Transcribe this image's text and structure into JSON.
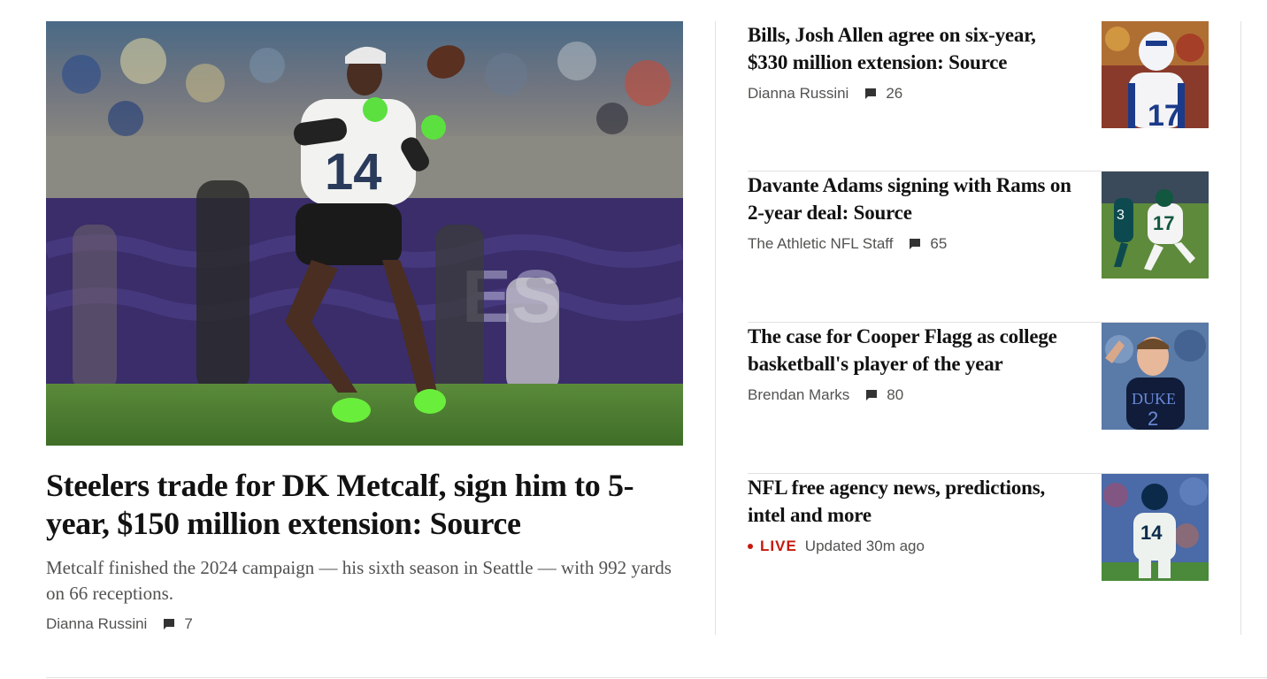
{
  "lead": {
    "image_alt": "Player in white jersey catching a football on a field",
    "title": "Steelers trade for DK Metcalf, sign him to 5-year, $150 million extension: Source",
    "deck": "Metcalf finished the 2024 campaign — his sixth season in Seattle — with 992 yards on 66 receptions.",
    "byline": "Dianna Russini",
    "comment_count": "7",
    "jersey_number": "14"
  },
  "stories": [
    {
      "title": "Bills, Josh Allen agree on six-year, $330 million extension: Source",
      "byline": "Dianna Russini",
      "comment_count": "26",
      "jersey_number": "17"
    },
    {
      "title": "Davante Adams signing with Rams on 2-year deal: Source",
      "byline": "The Athletic NFL Staff",
      "comment_count": "65",
      "jersey_number": "17"
    },
    {
      "title": "The case for Cooper Flagg as college basketball's player of the year",
      "byline": "Brendan Marks",
      "comment_count": "80",
      "jersey_number": "2",
      "jersey_text": "DUKE"
    },
    {
      "title": "NFL free agency news, predictions, intel and more",
      "live_label": "LIVE",
      "updated": "Updated 30m ago",
      "jersey_number": "14"
    }
  ],
  "icons": {
    "comment": "comment-icon",
    "live": "live-dot-icon"
  },
  "colors": {
    "live": "#c41a0d",
    "byline": "#52524f",
    "headline": "#121212",
    "rule": "#e2e2e2"
  }
}
